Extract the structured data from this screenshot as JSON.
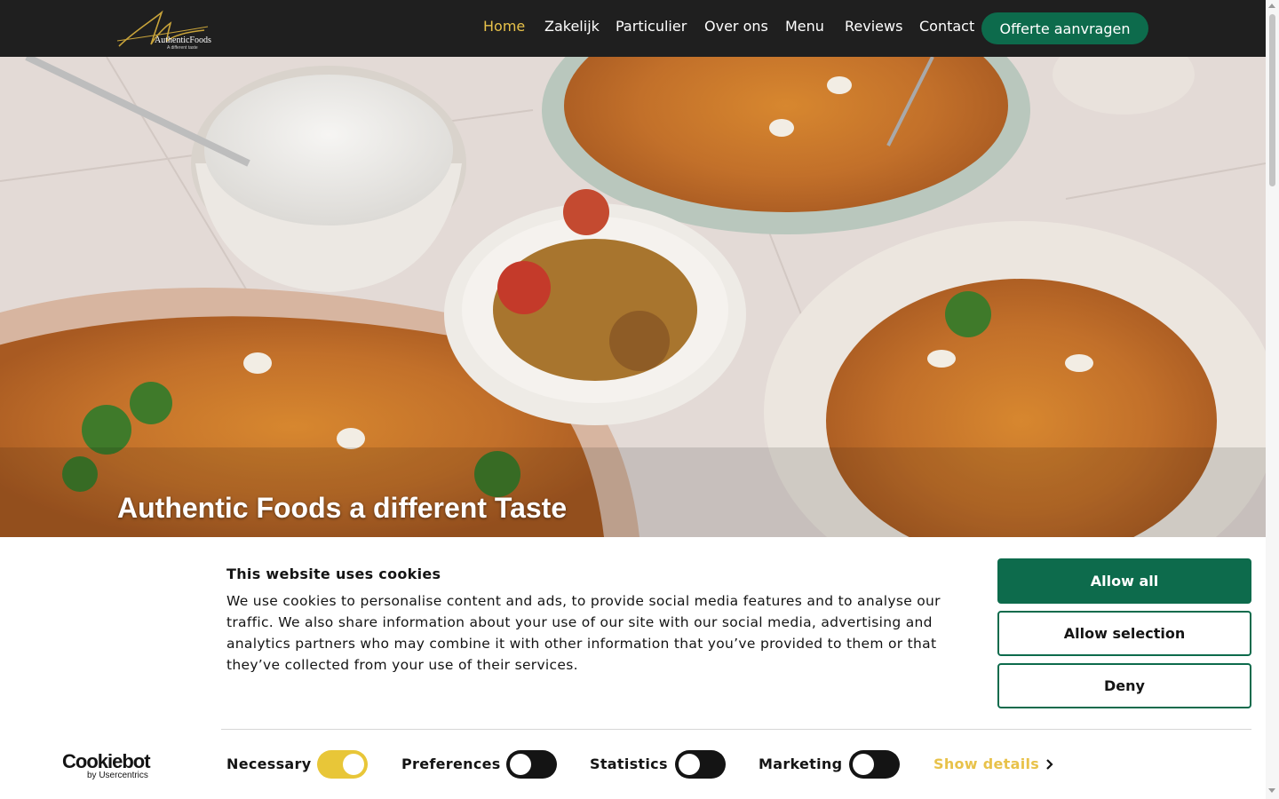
{
  "header": {
    "logo_text": "AuthenticFoods",
    "logo_tagline": "A different taste",
    "nav": [
      {
        "label": "Home",
        "active": true
      },
      {
        "label": "Zakelijk",
        "active": false
      },
      {
        "label": "Particulier",
        "active": false
      },
      {
        "label": "Over ons",
        "active": false
      },
      {
        "label": "Menu",
        "active": false
      },
      {
        "label": "Reviews",
        "active": false
      },
      {
        "label": "Contact",
        "active": false
      }
    ],
    "cta_label": "Offerte aanvragen"
  },
  "hero": {
    "title": "Authentic Foods a different Taste"
  },
  "cookie": {
    "title": "This website uses cookies",
    "text": "We use cookies to personalise content and ads, to provide social media features and to analyse our traffic. We also share information about your use of our site with our social media, advertising and analytics partners who may combine it with other information that you’ve provided to them or that they’ve collected from your use of their services.",
    "allow_all": "Allow all",
    "allow_selection": "Allow selection",
    "deny": "Deny",
    "brand": "Cookiebot",
    "brand_sub": "by Usercentrics",
    "toggles": [
      {
        "label": "Necessary",
        "on": true
      },
      {
        "label": "Preferences",
        "on": false
      },
      {
        "label": "Statistics",
        "on": false
      },
      {
        "label": "Marketing",
        "on": false
      }
    ],
    "show_details": "Show details"
  },
  "colors": {
    "header_bg": "#1f1f1f",
    "accent_green": "#0d6b4c",
    "accent_gold": "#e8c24a",
    "toggle_on": "#e8c638"
  }
}
